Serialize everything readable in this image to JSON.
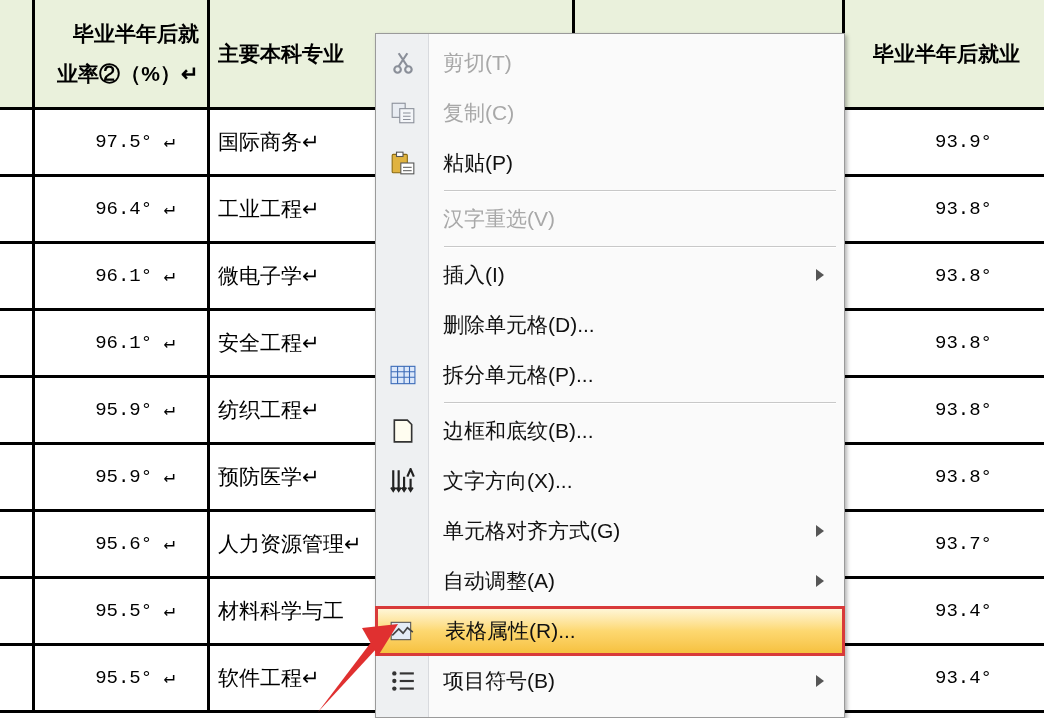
{
  "table": {
    "header": {
      "rate_lines": [
        "毕业半年后就",
        "业率②（%）↵"
      ],
      "major": "主要本科专业",
      "rate_right": "毕业半年后就业"
    },
    "rows": [
      {
        "rate": "97.5° ↵",
        "major": "国际商务↵",
        "rate_right": "93.9°"
      },
      {
        "rate": "96.4° ↵",
        "major": "工业工程↵",
        "rate_right": "93.8°"
      },
      {
        "rate": "96.1° ↵",
        "major": "微电子学↵",
        "rate_right": "93.8°"
      },
      {
        "rate": "96.1° ↵",
        "major": "安全工程↵",
        "rate_right": "93.8°"
      },
      {
        "rate": "95.9° ↵",
        "major": "纺织工程↵",
        "rate_right": "93.8°"
      },
      {
        "rate": "95.9° ↵",
        "major": "预防医学↵",
        "rate_right": "93.8°"
      },
      {
        "rate": "95.6° ↵",
        "major": "人力资源管理↵",
        "rate_right": "93.7°"
      },
      {
        "rate": "95.5° ↵",
        "major": "材料科学与工",
        "rate_right": "93.4°"
      },
      {
        "rate": "95.5° ↵",
        "major": "软件工程↵",
        "rate_right": "93.4°"
      }
    ]
  },
  "context_menu": {
    "items": [
      {
        "kind": "item",
        "label": "剪切(T)",
        "disabled": true,
        "submenu": false,
        "selected": false
      },
      {
        "kind": "item",
        "label": "复制(C)",
        "disabled": true,
        "submenu": false,
        "selected": false
      },
      {
        "kind": "item",
        "label": "粘贴(P)",
        "disabled": false,
        "submenu": false,
        "selected": false
      },
      {
        "kind": "separator"
      },
      {
        "kind": "item",
        "label": "汉字重选(V)",
        "disabled": true,
        "submenu": false,
        "selected": false
      },
      {
        "kind": "separator"
      },
      {
        "kind": "item",
        "label": "插入(I)",
        "disabled": false,
        "submenu": true,
        "selected": false
      },
      {
        "kind": "item",
        "label": "删除单元格(D)...",
        "disabled": false,
        "submenu": false,
        "selected": false
      },
      {
        "kind": "item",
        "label": "拆分单元格(P)...",
        "disabled": false,
        "submenu": false,
        "selected": false
      },
      {
        "kind": "separator"
      },
      {
        "kind": "item",
        "label": "边框和底纹(B)...",
        "disabled": false,
        "submenu": false,
        "selected": false
      },
      {
        "kind": "item",
        "label": "文字方向(X)...",
        "disabled": false,
        "submenu": false,
        "selected": false
      },
      {
        "kind": "item",
        "label": "单元格对齐方式(G)",
        "disabled": false,
        "submenu": true,
        "selected": false
      },
      {
        "kind": "item",
        "label": "自动调整(A)",
        "disabled": false,
        "submenu": true,
        "selected": false
      },
      {
        "kind": "item",
        "label": "表格属性(R)...",
        "disabled": false,
        "submenu": false,
        "selected": true
      },
      {
        "kind": "item",
        "label": "项目符号(B)",
        "disabled": false,
        "submenu": true,
        "selected": false
      }
    ]
  }
}
